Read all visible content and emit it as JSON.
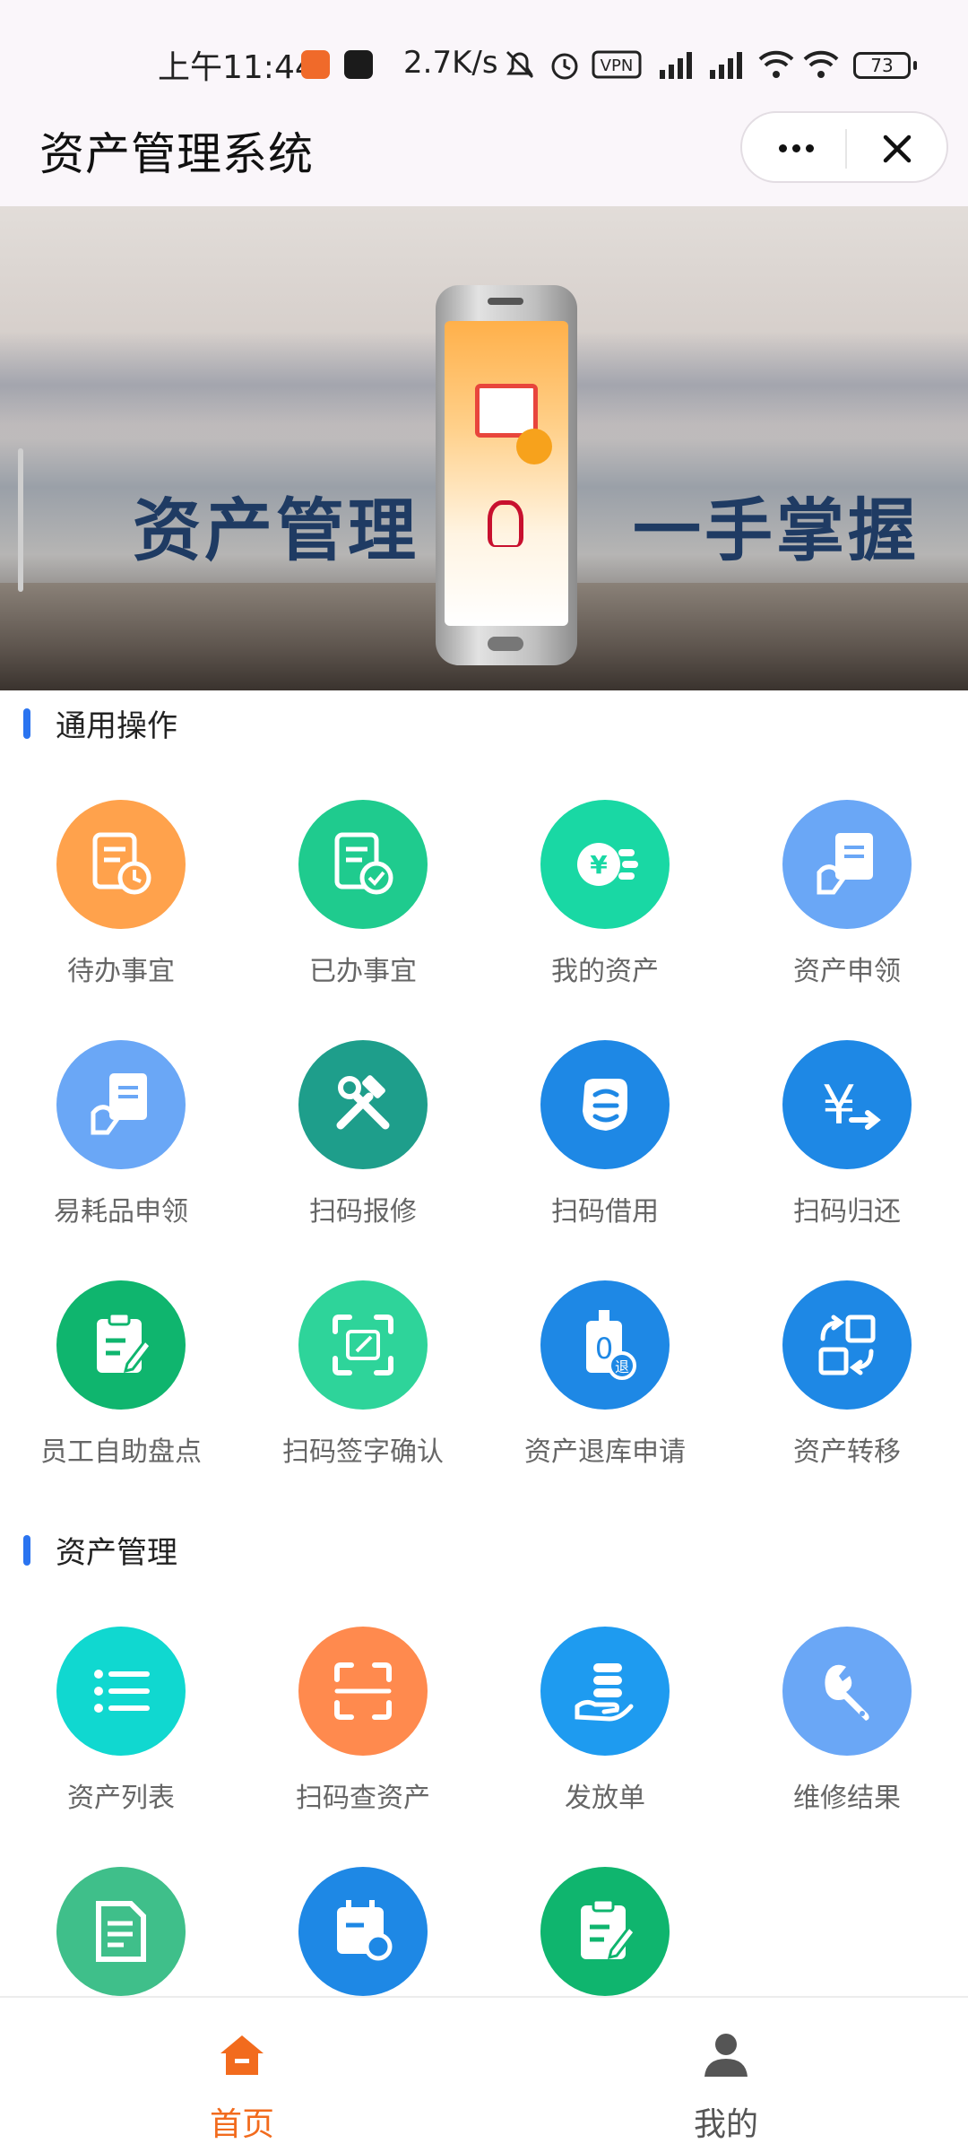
{
  "status_bar": {
    "time": "上午11:44",
    "speed": "2.7K/s",
    "battery": "73"
  },
  "titlebar": {
    "title": "资产管理系统"
  },
  "banner": {
    "text_left": "资产管理",
    "text_right": "一手掌握"
  },
  "sections": [
    {
      "title": "通用操作",
      "items": [
        {
          "label": "待办事宜",
          "color": "#FFA24C",
          "icon": "todo-doc-clock-icon"
        },
        {
          "label": "已办事宜",
          "color": "#1FCB8E",
          "icon": "done-doc-check-icon"
        },
        {
          "label": "我的资产",
          "color": "#19D8A4",
          "icon": "yen-coins-icon"
        },
        {
          "label": "资产申领",
          "color": "#6AA7F6",
          "icon": "hand-document-icon"
        },
        {
          "label": "易耗品申领",
          "color": "#6AA7F6",
          "icon": "hand-document-icon"
        },
        {
          "label": "扫码报修",
          "color": "#1E9E8B",
          "icon": "hammer-wrench-icon"
        },
        {
          "label": "扫码借用",
          "color": "#1E88E5",
          "icon": "hand-coin-icon"
        },
        {
          "label": "扫码归还",
          "color": "#1E88E5",
          "icon": "yen-arrow-icon"
        },
        {
          "label": "员工自助盘点",
          "color": "#0FB56E",
          "icon": "clipboard-pen-icon"
        },
        {
          "label": "扫码签字确认",
          "color": "#2ED49A",
          "icon": "scan-sign-icon"
        },
        {
          "label": "资产退库申请",
          "color": "#1E88E5",
          "icon": "tag-return-icon"
        },
        {
          "label": "资产转移",
          "color": "#1E88E5",
          "icon": "transfer-icon"
        }
      ]
    },
    {
      "title": "资产管理",
      "items": [
        {
          "label": "资产列表",
          "color": "#10D8D0",
          "icon": "list-icon"
        },
        {
          "label": "扫码查资产",
          "color": "#FF8A4E",
          "icon": "scan-frame-icon"
        },
        {
          "label": "发放单",
          "color": "#1E9BF0",
          "icon": "hand-stack-icon"
        },
        {
          "label": "维修结果",
          "color": "#6AA7F6",
          "icon": "wrench-icon"
        },
        {
          "label": "",
          "color": "#3FBF8A",
          "icon": "document-icon"
        },
        {
          "label": "",
          "color": "#1E88E5",
          "icon": "calendar-gear-icon"
        },
        {
          "label": "",
          "color": "#0FB56E",
          "icon": "clipboard-pen-icon"
        }
      ]
    }
  ],
  "tabbar": {
    "home": "首页",
    "mine": "我的",
    "active_color": "#F26B1D",
    "inactive_color": "#555555"
  }
}
